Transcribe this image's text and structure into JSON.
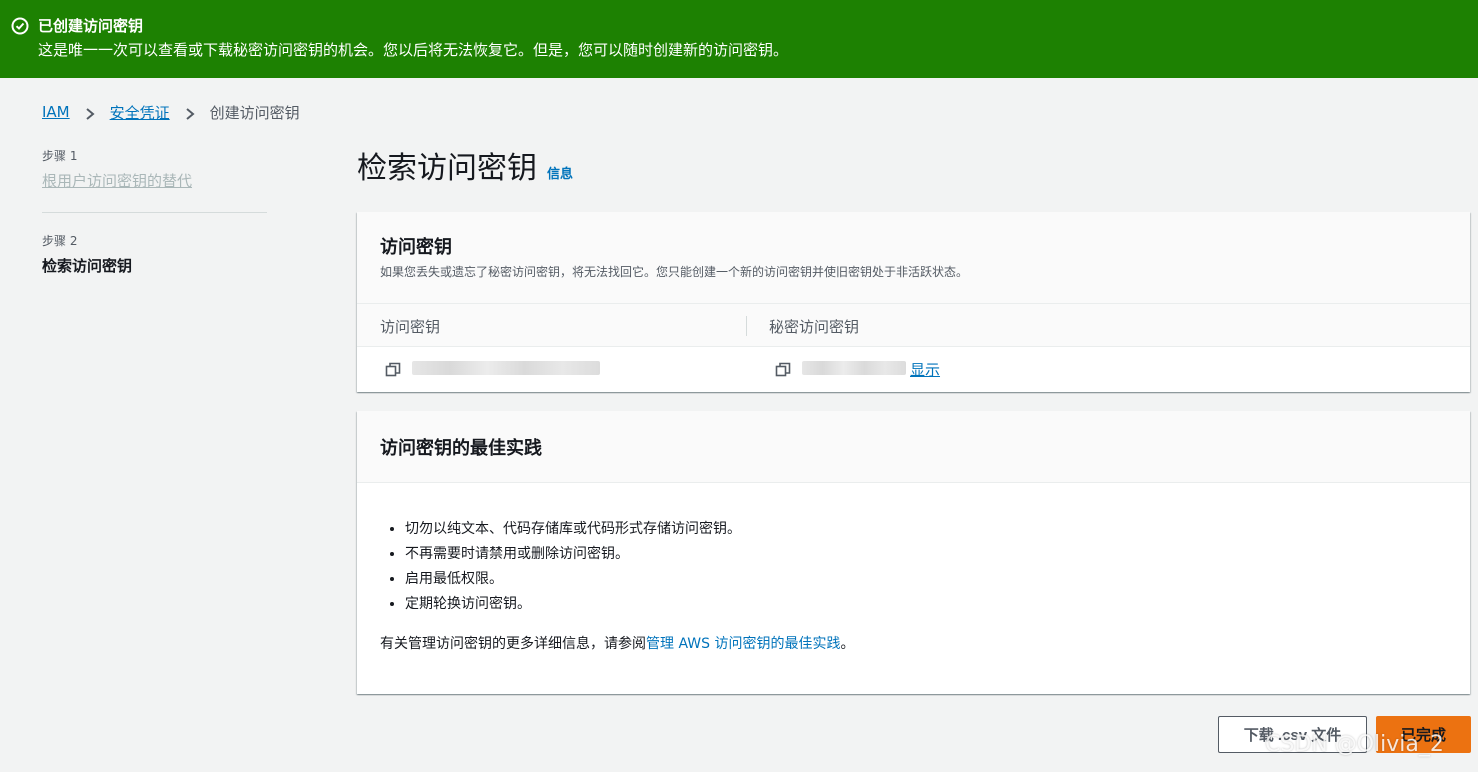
{
  "banner": {
    "title": "已创建访问密钥",
    "message": "这是唯一一次可以查看或下载秘密访问密钥的机会。您以后将无法恢复它。但是，您可以随时创建新的访问密钥。",
    "color": "#1d8102"
  },
  "breadcrumb": {
    "items": [
      "IAM",
      "安全凭证",
      "创建访问密钥"
    ]
  },
  "steps": [
    {
      "label": "步骤 1",
      "title": "根用户访问密钥的替代"
    },
    {
      "label": "步骤 2",
      "title": "检索访问密钥"
    }
  ],
  "page": {
    "title": "检索访问密钥",
    "info_link": "信息"
  },
  "access_key_card": {
    "title": "访问密钥",
    "description": "如果您丢失或遗忘了秘密访问密钥，将无法找回它。您只能创建一个新的访问密钥并使旧密钥处于非活跃状态。",
    "columns": [
      "访问密钥",
      "秘密访问密钥"
    ],
    "show_link": "显示"
  },
  "best_practices_card": {
    "title": "访问密钥的最佳实践",
    "items": [
      "切勿以纯文本、代码存储库或代码形式存储访问密钥。",
      "不再需要时请禁用或删除访问密钥。",
      "启用最低权限。",
      "定期轮换访问密钥。"
    ],
    "more_prefix": "有关管理访问密钥的更多详细信息，请参阅",
    "more_link": "管理 AWS 访问密钥的最佳实践",
    "more_suffix": "。"
  },
  "buttons": {
    "download": "下载 .csv 文件",
    "done": "已完成"
  },
  "watermark": "CSDN @Olivia_2",
  "colors": {
    "link": "#0073bb",
    "primary_button": "#ec7211",
    "background": "#f2f3f3"
  }
}
